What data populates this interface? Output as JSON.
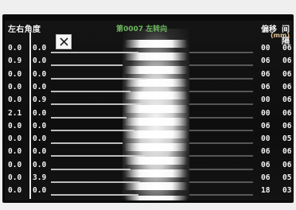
{
  "header": {
    "left_title": "左右角度",
    "center_title": "第0007 左转向",
    "right_col_1": "偏移",
    "right_col_2": "间隔",
    "unit": "(mm)"
  },
  "close_button": {
    "label": "✕"
  },
  "rows": [
    {
      "left": "0.0",
      "right": "0.0",
      "shift": "00",
      "time": "06"
    },
    {
      "left": "0.9",
      "right": "0.0",
      "shift": "06",
      "time": "06"
    },
    {
      "left": "0.0",
      "right": "0.0",
      "shift": "06",
      "time": "06"
    },
    {
      "left": "0.0",
      "right": "0.0",
      "shift": "06",
      "time": "06"
    },
    {
      "left": "0.0",
      "right": "0.9",
      "shift": "00",
      "time": "06"
    },
    {
      "left": "2.1",
      "right": "0.0",
      "shift": "00",
      "time": "06"
    },
    {
      "left": "0.0",
      "right": "0.0",
      "shift": "06",
      "time": "06"
    },
    {
      "left": "0.0",
      "right": "0.0",
      "shift": "00",
      "time": "05"
    },
    {
      "left": "0.0",
      "right": "0.0",
      "shift": "06",
      "time": "06"
    },
    {
      "left": "0.0",
      "right": "0.0",
      "shift": "06",
      "time": "06"
    },
    {
      "left": "0.0",
      "right": "3.9",
      "shift": "06",
      "time": "05"
    },
    {
      "left": "0.0",
      "right": "0.0",
      "shift": "18",
      "time": "03"
    }
  ]
}
